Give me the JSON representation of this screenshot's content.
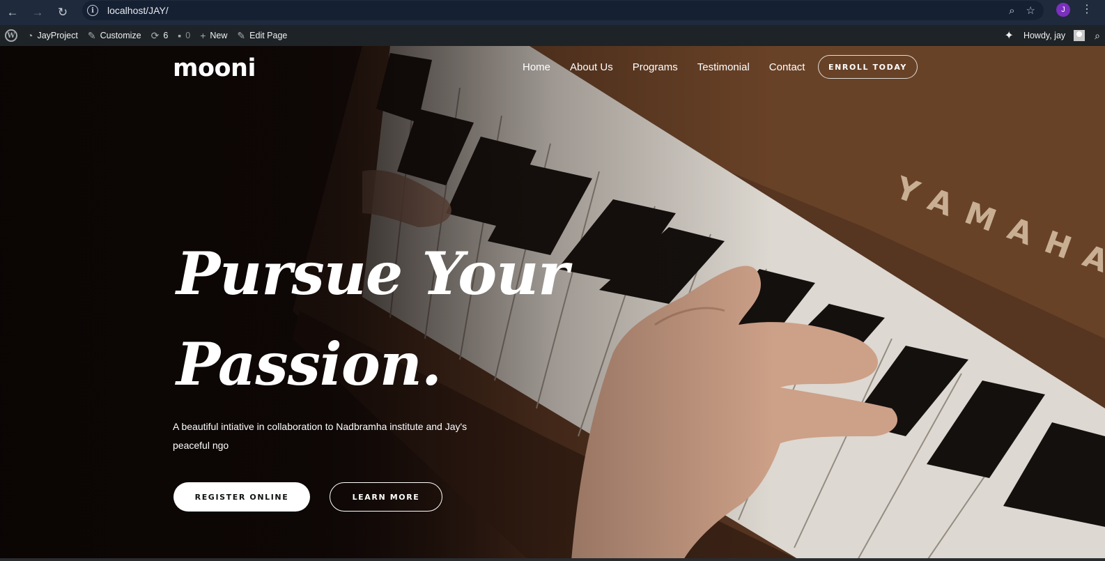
{
  "browser": {
    "url": "localhost/JAY/",
    "back_icon": "arrow-left-icon",
    "forward_icon": "arrow-right-icon",
    "reload_icon": "reload-icon",
    "profile_initial": "J",
    "profile_color": "#7b2fbe"
  },
  "admin_bar": {
    "site_name": "JayProject",
    "customize": "Customize",
    "updates_count": "6",
    "comments_count": "0",
    "new_label": "New",
    "edit_label": "Edit Page",
    "greeting": "Howdy, jay"
  },
  "site": {
    "logo": "mooni",
    "nav": [
      "Home",
      "About Us",
      "Programs",
      "Testimonial",
      "Contact"
    ],
    "enroll": "ENROLL TODAY"
  },
  "hero": {
    "title_line1": "Pursue Your",
    "title_line2": "Passion.",
    "description": "A beautiful intiative in collaboration to Nadbramha institute and Jay's peaceful ngo",
    "register": "REGISTER ONLINE",
    "learn_more": "LEARN MORE",
    "piano_brand": "YAMAHA"
  }
}
